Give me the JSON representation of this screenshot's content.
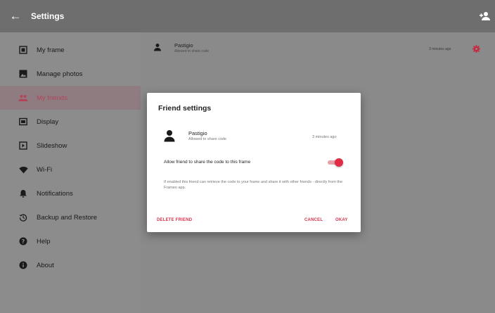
{
  "app": {
    "title": "Settings"
  },
  "sidebar": {
    "items": [
      {
        "label": "My frame",
        "icon": "frame-icon"
      },
      {
        "label": "Manage photos",
        "icon": "photos-icon"
      },
      {
        "label": "My friends",
        "icon": "friends-icon",
        "active": true
      },
      {
        "label": "Display",
        "icon": "display-icon"
      },
      {
        "label": "Slideshow",
        "icon": "slideshow-icon"
      },
      {
        "label": "Wi-Fi",
        "icon": "wifi-icon"
      },
      {
        "label": "Notifications",
        "icon": "bell-icon"
      },
      {
        "label": "Backup and Restore",
        "icon": "restore-icon"
      },
      {
        "label": "Help",
        "icon": "help-icon"
      },
      {
        "label": "About",
        "icon": "info-icon"
      }
    ]
  },
  "friends": [
    {
      "name": "Pastigio",
      "status": "Allowed to share code",
      "time": "3 minutes ago"
    }
  ],
  "dialog": {
    "title": "Friend settings",
    "friend_name": "Pastigio",
    "friend_status": "Allowed to share code",
    "friend_time": "3 minutes ago",
    "toggle_label": "Allow friend to share the code to this frame",
    "toggle_on": true,
    "description": "If enabled this friend can retrieve the code to your frame and share it with other friends - directly from the Frameo app.",
    "delete_label": "DELETE FRIEND",
    "cancel_label": "CANCEL",
    "okay_label": "OKAY"
  },
  "colors": {
    "accent": "#e02d45",
    "active_label": "#b2455a"
  }
}
